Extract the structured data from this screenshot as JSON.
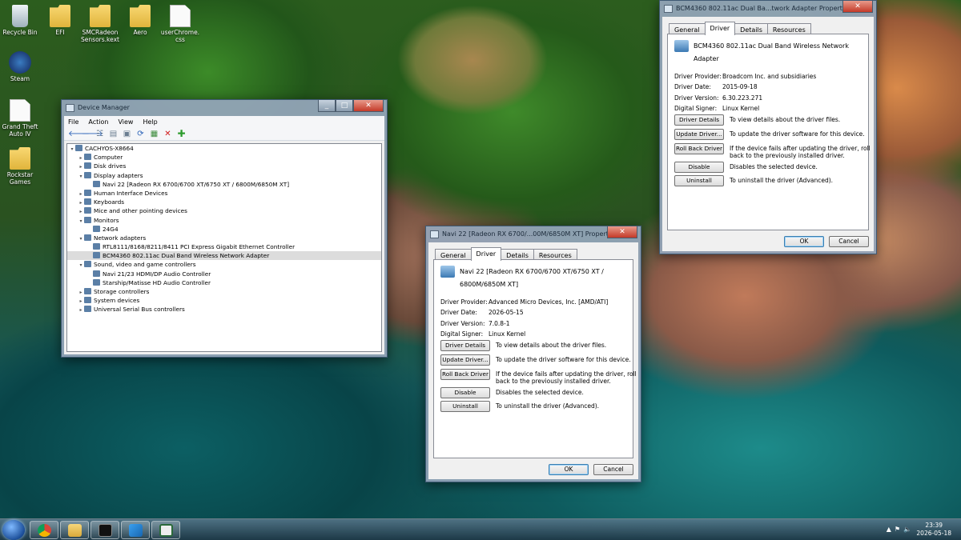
{
  "desktop": {
    "icons": [
      {
        "label": "Recycle Bin",
        "icon": "recycle-bin-icon"
      },
      {
        "label": "EFI",
        "icon": "folder-icon"
      },
      {
        "label": "SMCRadeon Sensors.kext",
        "icon": "folder-icon"
      },
      {
        "label": "Aero",
        "icon": "folder-icon"
      },
      {
        "label": "userChrome. css",
        "icon": "file-icon"
      },
      {
        "label": "Steam",
        "icon": "steam-icon"
      },
      {
        "label": "Grand Theft Auto IV",
        "icon": "file-icon"
      },
      {
        "label": "Rockstar Games",
        "icon": "folder-icon"
      }
    ]
  },
  "device_manager": {
    "title": "Device Manager",
    "menu": [
      "File",
      "Action",
      "View",
      "Help"
    ],
    "tree": [
      {
        "label": "CACHYOS-X8664",
        "level": 0,
        "expander": "−"
      },
      {
        "label": "Computer",
        "level": 1,
        "expander": "+"
      },
      {
        "label": "Disk drives",
        "level": 1,
        "expander": "+"
      },
      {
        "label": "Display adapters",
        "level": 1,
        "expander": "−"
      },
      {
        "label": "Navi 22 [Radeon RX 6700/6700 XT/6750 XT / 6800M/6850M XT]",
        "level": 2,
        "expander": ""
      },
      {
        "label": "Human Interface Devices",
        "level": 1,
        "expander": "+"
      },
      {
        "label": "Keyboards",
        "level": 1,
        "expander": "+"
      },
      {
        "label": "Mice and other pointing devices",
        "level": 1,
        "expander": "+"
      },
      {
        "label": "Monitors",
        "level": 1,
        "expander": "−"
      },
      {
        "label": "24G4",
        "level": 2,
        "expander": ""
      },
      {
        "label": "Network adapters",
        "level": 1,
        "expander": "−"
      },
      {
        "label": "RTL8111/8168/8211/8411 PCI Express Gigabit Ethernet Controller",
        "level": 2,
        "expander": ""
      },
      {
        "label": "BCM4360 802.11ac Dual Band Wireless Network Adapter",
        "level": 2,
        "expander": "",
        "selected": true
      },
      {
        "label": "Sound, video and game controllers",
        "level": 1,
        "expander": "−"
      },
      {
        "label": "Navi 21/23 HDMI/DP Audio Controller",
        "level": 2,
        "expander": ""
      },
      {
        "label": "Starship/Matisse HD Audio Controller",
        "level": 2,
        "expander": ""
      },
      {
        "label": "Storage controllers",
        "level": 1,
        "expander": "+"
      },
      {
        "label": "System devices",
        "level": 1,
        "expander": "+"
      },
      {
        "label": "Universal Serial Bus controllers",
        "level": 1,
        "expander": "+"
      }
    ]
  },
  "bcm_dialog": {
    "title": "BCM4360 802.11ac Dual Ba...twork Adapter Properties",
    "tabs": [
      "General",
      "Driver",
      "Details",
      "Resources"
    ],
    "active_tab": "Driver",
    "device_name": "BCM4360 802.11ac Dual Band Wireless Network Adapter",
    "props": [
      {
        "key": "Driver Provider:",
        "value": "Broadcom Inc. and subsidiaries"
      },
      {
        "key": "Driver Date:",
        "value": "2015-09-18"
      },
      {
        "key": "Driver Version:",
        "value": "6.30.223.271"
      },
      {
        "key": "Digital Signer:",
        "value": "Linux Kernel"
      }
    ],
    "actions": [
      {
        "label": "Driver Details",
        "desc": "To view details about the driver files."
      },
      {
        "label": "Update Driver...",
        "desc": "To update the driver software for this device."
      },
      {
        "label": "Roll Back Driver",
        "desc": "If the device fails after updating the driver, roll back to the previously installed driver."
      },
      {
        "label": "Disable",
        "desc": "Disables the selected device."
      },
      {
        "label": "Uninstall",
        "desc": "To uninstall the driver (Advanced)."
      }
    ],
    "ok": "OK",
    "cancel": "Cancel"
  },
  "navi_dialog": {
    "title": "Navi 22 [Radeon RX 6700/...00M/6850M XT] Properties",
    "tabs": [
      "General",
      "Driver",
      "Details",
      "Resources"
    ],
    "active_tab": "Driver",
    "device_name": "Navi 22 [Radeon RX 6700/6700 XT/6750 XT / 6800M/6850M XT]",
    "props": [
      {
        "key": "Driver Provider:",
        "value": "Advanced Micro Devices, Inc. [AMD/ATI]"
      },
      {
        "key": "Driver Date:",
        "value": "2026-05-15"
      },
      {
        "key": "Driver Version:",
        "value": "7.0.8-1"
      },
      {
        "key": "Digital Signer:",
        "value": "Linux Kernel"
      }
    ],
    "actions": [
      {
        "label": "Driver Details",
        "desc": "To view details about the driver files."
      },
      {
        "label": "Update Driver...",
        "desc": "To update the driver software for this device."
      },
      {
        "label": "Roll Back Driver",
        "desc": "If the device fails after updating the driver, roll back to the previously installed driver."
      },
      {
        "label": "Disable",
        "desc": "Disables the selected device."
      },
      {
        "label": "Uninstall",
        "desc": "To uninstall the driver (Advanced)."
      }
    ],
    "ok": "OK",
    "cancel": "Cancel"
  },
  "taskbar": {
    "apps": [
      "chrome-icon",
      "file-explorer-icon",
      "terminal-icon",
      "vscode-icon",
      "device-manager-icon"
    ],
    "time": "23:39",
    "date": "2026-05-18"
  }
}
